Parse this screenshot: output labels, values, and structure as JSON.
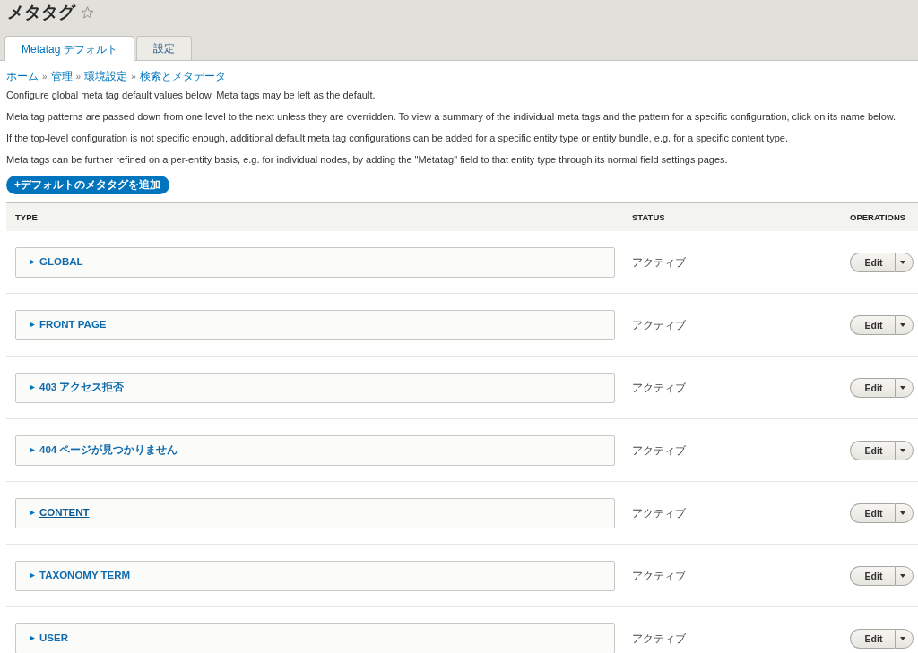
{
  "page": {
    "title": "メタタグ"
  },
  "tabs": [
    {
      "label": "Metatag デフォルト",
      "selected": true
    },
    {
      "label": "設定",
      "selected": false
    }
  ],
  "breadcrumb": {
    "separator": "»",
    "items": [
      "ホーム",
      "管理",
      "環境設定",
      "検索とメタデータ"
    ]
  },
  "description": [
    "Configure global meta tag default values below. Meta tags may be left as the default.",
    "Meta tag patterns are passed down from one level to the next unless they are overridden. To view a summary of the individual meta tags and the pattern for a specific configuration, click on its name below.",
    "If the top-level configuration is not specific enough, additional default meta tag configurations can be added for a specific entity type or entity bundle, e.g. for a specific content type.",
    "Meta tags can be further refined on a per-entity basis, e.g. for individual nodes, by adding the \"Metatag\" field to that entity type through its normal field settings pages."
  ],
  "add_button": {
    "label": "+デフォルトのメタタグを追加"
  },
  "table": {
    "columns": [
      "TYPE",
      "STATUS",
      "OPERATIONS"
    ],
    "rows": [
      {
        "type": "GLOBAL",
        "expanded": false,
        "hover": false,
        "status": "アクティブ",
        "operation": "Edit"
      },
      {
        "type": "FRONT PAGE",
        "expanded": false,
        "hover": false,
        "status": "アクティブ",
        "operation": "Edit"
      },
      {
        "type": "403 アクセス拒否",
        "expanded": false,
        "hover": false,
        "status": "アクティブ",
        "operation": "Edit"
      },
      {
        "type": "404 ページが見つかりません",
        "expanded": false,
        "hover": false,
        "status": "アクティブ",
        "operation": "Edit"
      },
      {
        "type": "CONTENT",
        "expanded": false,
        "hover": true,
        "status": "アクティブ",
        "operation": "Edit"
      },
      {
        "type": "TAXONOMY TERM",
        "expanded": false,
        "hover": false,
        "status": "アクティブ",
        "operation": "Edit"
      },
      {
        "type": "USER",
        "expanded": false,
        "hover": false,
        "status": "アクティブ",
        "operation": "Edit"
      }
    ]
  }
}
